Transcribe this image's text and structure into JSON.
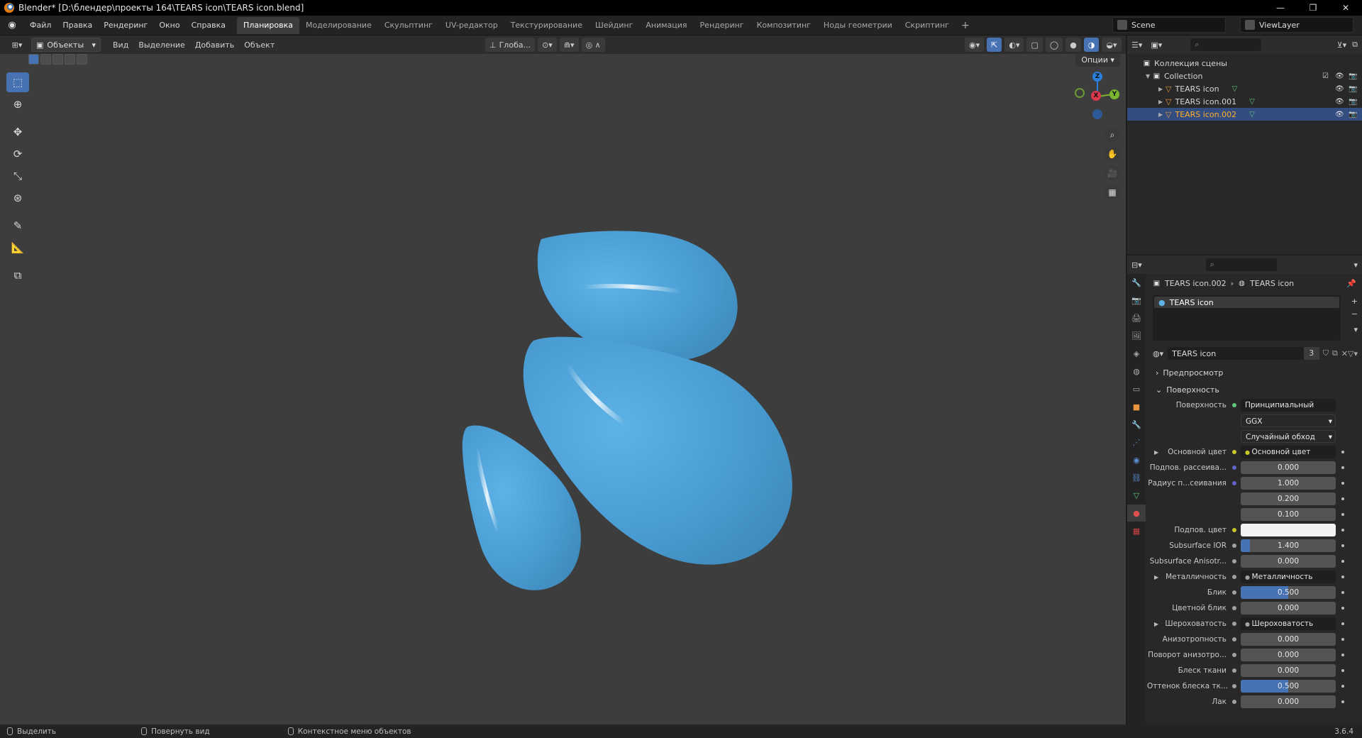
{
  "window": {
    "title": "Blender* [D:\\блендер\\проекты 164\\TEARS icon\\TEARS icon.blend]",
    "minimize": "—",
    "restore": "❐",
    "close": "✕"
  },
  "menu": {
    "items": [
      "Файл",
      "Правка",
      "Рендеринг",
      "Окно",
      "Справка"
    ],
    "workspaces": [
      "Планировка",
      "Моделирование",
      "Скульптинг",
      "UV-редактор",
      "Текстурирование",
      "Шейдинг",
      "Анимация",
      "Рендеринг",
      "Композитинг",
      "Ноды геометрии",
      "Скриптинг"
    ],
    "active_workspace": "Планировка",
    "add": "+",
    "scene": "Scene",
    "view_layer": "ViewLayer"
  },
  "viewport_header": {
    "mode": "Объекты",
    "menus": [
      "Вид",
      "Выделение",
      "Добавить",
      "Объект"
    ],
    "orientation": "Глоба...",
    "options": "Опции"
  },
  "gizmo": {
    "z": "Z",
    "x": "X",
    "y": "Y"
  },
  "outliner": {
    "scene_collection": "Коллекция сцены",
    "collection": "Collection",
    "objects": [
      {
        "name": "TEARS icon",
        "selected": false
      },
      {
        "name": "TEARS icon.001",
        "selected": false
      },
      {
        "name": "TEARS icon.002",
        "selected": true
      }
    ]
  },
  "properties": {
    "breadcrumb": {
      "object": "TEARS icon.002",
      "material": "TEARS icon"
    },
    "slot": "TEARS icon",
    "material_name": "TEARS icon",
    "material_users": "3",
    "panels": {
      "preview": "Предпросмотр",
      "surface": "Поверхность"
    },
    "surface": {
      "label": "Поверхность",
      "shader": "Принципиальный BSDF",
      "distribution": "GGX",
      "subsurface_method": "Случайный обход"
    },
    "rows": [
      {
        "label": "Основной цвет",
        "value": "Основной цвет",
        "kind": "link",
        "sock": "#c7c729",
        "expand": true
      },
      {
        "label": "Подпов. рассеива...",
        "value": "0.000",
        "kind": "num",
        "sock": "#6363c7",
        "fill": 0
      },
      {
        "label": "Радиус п...сеивания",
        "value": "1.000",
        "kind": "num",
        "sock": "#6363c7",
        "fill": 0
      },
      {
        "label": "",
        "value": "0.200",
        "kind": "num",
        "sock": "",
        "fill": 0
      },
      {
        "label": "",
        "value": "0.100",
        "kind": "num",
        "sock": "",
        "fill": 0
      },
      {
        "label": "Подпов. цвет",
        "value": "",
        "kind": "color",
        "sock": "#c7c729",
        "color": "#f2f2f2"
      },
      {
        "label": "Subsurface IOR",
        "value": "1.400",
        "kind": "num",
        "sock": "#a1a1a1",
        "fill": 0.1
      },
      {
        "label": "Subsurface Anisotr...",
        "value": "0.000",
        "kind": "num",
        "sock": "#a1a1a1",
        "fill": 0
      },
      {
        "label": "Металличность",
        "value": "Металличность",
        "kind": "link",
        "sock": "#a1a1a1",
        "expand": true
      },
      {
        "label": "Блик",
        "value": "0.500",
        "kind": "num",
        "sock": "#a1a1a1",
        "fill": 0.5
      },
      {
        "label": "Цветной блик",
        "value": "0.000",
        "kind": "num",
        "sock": "#a1a1a1",
        "fill": 0
      },
      {
        "label": "Шероховатость",
        "value": "Шероховатость",
        "kind": "link",
        "sock": "#a1a1a1",
        "expand": true
      },
      {
        "label": "Анизотропность",
        "value": "0.000",
        "kind": "num",
        "sock": "#a1a1a1",
        "fill": 0
      },
      {
        "label": "Поворот анизотро...",
        "value": "0.000",
        "kind": "num",
        "sock": "#a1a1a1",
        "fill": 0
      },
      {
        "label": "Блеск ткани",
        "value": "0.000",
        "kind": "num",
        "sock": "#a1a1a1",
        "fill": 0
      },
      {
        "label": "Оттенок блеска тк...",
        "value": "0.500",
        "kind": "num",
        "sock": "#a1a1a1",
        "fill": 0.5
      },
      {
        "label": "Лак",
        "value": "0.000",
        "kind": "num",
        "sock": "#a1a1a1",
        "fill": 0
      }
    ]
  },
  "status": {
    "select": "Выделить",
    "rotate": "Повернуть вид",
    "context": "Контекстное меню объектов",
    "version": "3.6.4"
  },
  "colors": {
    "accent": "#4772b3",
    "drop": "#4b9fd4",
    "selected_text": "#ffaf29"
  }
}
